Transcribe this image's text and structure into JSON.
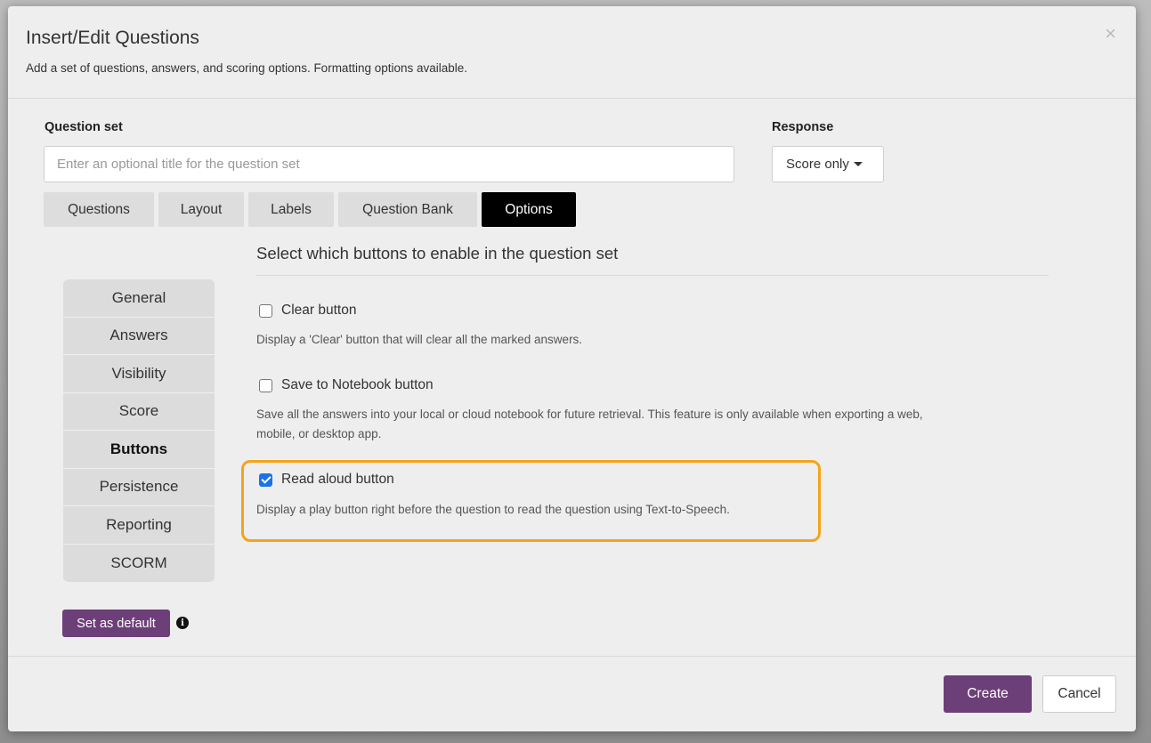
{
  "dialog": {
    "title": "Insert/Edit Questions",
    "subtitle": "Add a set of questions, answers, and scoring options. Formatting options available.",
    "close_symbol": "×"
  },
  "question_set": {
    "label": "Question set",
    "placeholder": "Enter an optional title for the question set",
    "value": ""
  },
  "response": {
    "label": "Response",
    "selected": "Score only"
  },
  "tabs": [
    {
      "label": "Questions",
      "active": false
    },
    {
      "label": "Layout",
      "active": false
    },
    {
      "label": "Labels",
      "active": false
    },
    {
      "label": "Question Bank",
      "active": false
    },
    {
      "label": "Options",
      "active": true
    }
  ],
  "side_nav": [
    {
      "label": "General",
      "active": false
    },
    {
      "label": "Answers",
      "active": false
    },
    {
      "label": "Visibility",
      "active": false
    },
    {
      "label": "Score",
      "active": false
    },
    {
      "label": "Buttons",
      "active": true
    },
    {
      "label": "Persistence",
      "active": false
    },
    {
      "label": "Reporting",
      "active": false
    },
    {
      "label": "SCORM",
      "active": false
    }
  ],
  "content": {
    "heading": "Select which buttons to enable in the question set",
    "options": [
      {
        "label": "Clear button",
        "checked": false,
        "description": "Display a 'Clear' button that will clear all the marked answers."
      },
      {
        "label": "Save to Notebook button",
        "checked": false,
        "description_line1": "Save all the answers into your local or cloud notebook for future retrieval. This feature is only available when exporting a web,",
        "description_line2": "mobile, or desktop app."
      },
      {
        "label": "Read aloud button",
        "checked": true,
        "description": "Display a play button right before the question to read the question using Text-to-Speech."
      }
    ]
  },
  "set_default": {
    "label": "Set as default",
    "info_symbol": "i"
  },
  "footer": {
    "create_label": "Create",
    "cancel_label": "Cancel"
  },
  "colors": {
    "accent_purple": "#6d3f78",
    "highlight_orange": "#f5a418",
    "checkbox_blue": "#1a73e8",
    "active_tab": "#000000"
  }
}
